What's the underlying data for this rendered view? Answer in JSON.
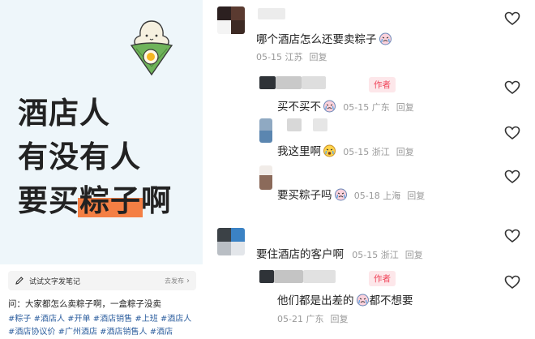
{
  "post": {
    "cover_lines": [
      "酒店人",
      "有没有人",
      "要买",
      "粽子",
      "啊"
    ],
    "draft_label": "试试文字发笔记",
    "draft_action": "去发布",
    "question": "问：大家都怎么卖粽子啊，一盒粽子没卖",
    "tags": [
      "#粽子",
      "#酒店人",
      "#开单",
      "#酒店销售",
      "#上班",
      "#酒店人",
      "#酒店协议价",
      "#广州酒店",
      "#酒店销售人",
      "#酒店"
    ]
  },
  "comments": [
    {
      "text": "哪个酒店怎么还要卖粽子",
      "date": "05-15",
      "location": "江苏",
      "reply": "回复",
      "author": false
    },
    {
      "text": "买不买不",
      "date": "05-15",
      "location": "广东",
      "reply": "回复",
      "author": true,
      "author_label": "作者"
    },
    {
      "text": "我这里啊",
      "date": "05-15",
      "location": "浙江",
      "reply": "回复",
      "author": false
    },
    {
      "text": "要买粽子吗",
      "date": "05-18",
      "location": "上海",
      "reply": "回复",
      "author": false
    },
    {
      "text": "要住酒店的客户啊",
      "date": "05-15",
      "location": "浙江",
      "reply": "回复",
      "author": false
    },
    {
      "text_before": "他们都是出差的",
      "text_after": "都不想要",
      "date": "05-21",
      "location": "广东",
      "reply": "回复",
      "author": true,
      "author_label": "作者"
    }
  ],
  "icons": {
    "like": "heart-outline-icon",
    "emoji": "crying-emoji-icon",
    "pencil": "pencil-icon",
    "chevron": "chevron-right-icon",
    "mascot": "zongzi-mascot-icon"
  },
  "colors": {
    "cover_bg": "#eef6fa",
    "highlight": "#f47f44",
    "author_tag_text": "#f0465b",
    "author_tag_bg": "#fde7ea",
    "tag_link": "#2e5f9f"
  }
}
